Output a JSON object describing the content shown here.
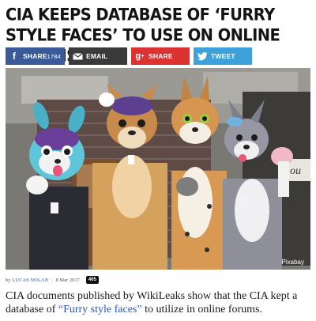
{
  "article": {
    "headline": "CIA keeps database of ‘furry style faces’ to use on online forums",
    "share": {
      "facebook": {
        "label": "SHARE",
        "count": "1784",
        "icon": "facebook-f-icon",
        "color": "#3b5b98"
      },
      "email": {
        "label": "EMAIL",
        "icon": "envelope-icon",
        "color": "#3a3a3a"
      },
      "googleplus": {
        "label": "SHARE",
        "icon": "google-plus-icon",
        "color": "#dd3232"
      },
      "twitter": {
        "label": "TWEET",
        "icon": "twitter-bird-icon",
        "color": "#3fa1d9"
      }
    },
    "image_credit": "Pixabay",
    "byline": {
      "prefix": "by",
      "author": "Lucas Nolan",
      "date": "8 Mar 2017",
      "badge": "405"
    },
    "lede_before": "CIA documents published by WikiLeaks show that the CIA kept a database of ",
    "lede_quote": "“Furry style faces”",
    "lede_after": " to utilize in online forums."
  }
}
